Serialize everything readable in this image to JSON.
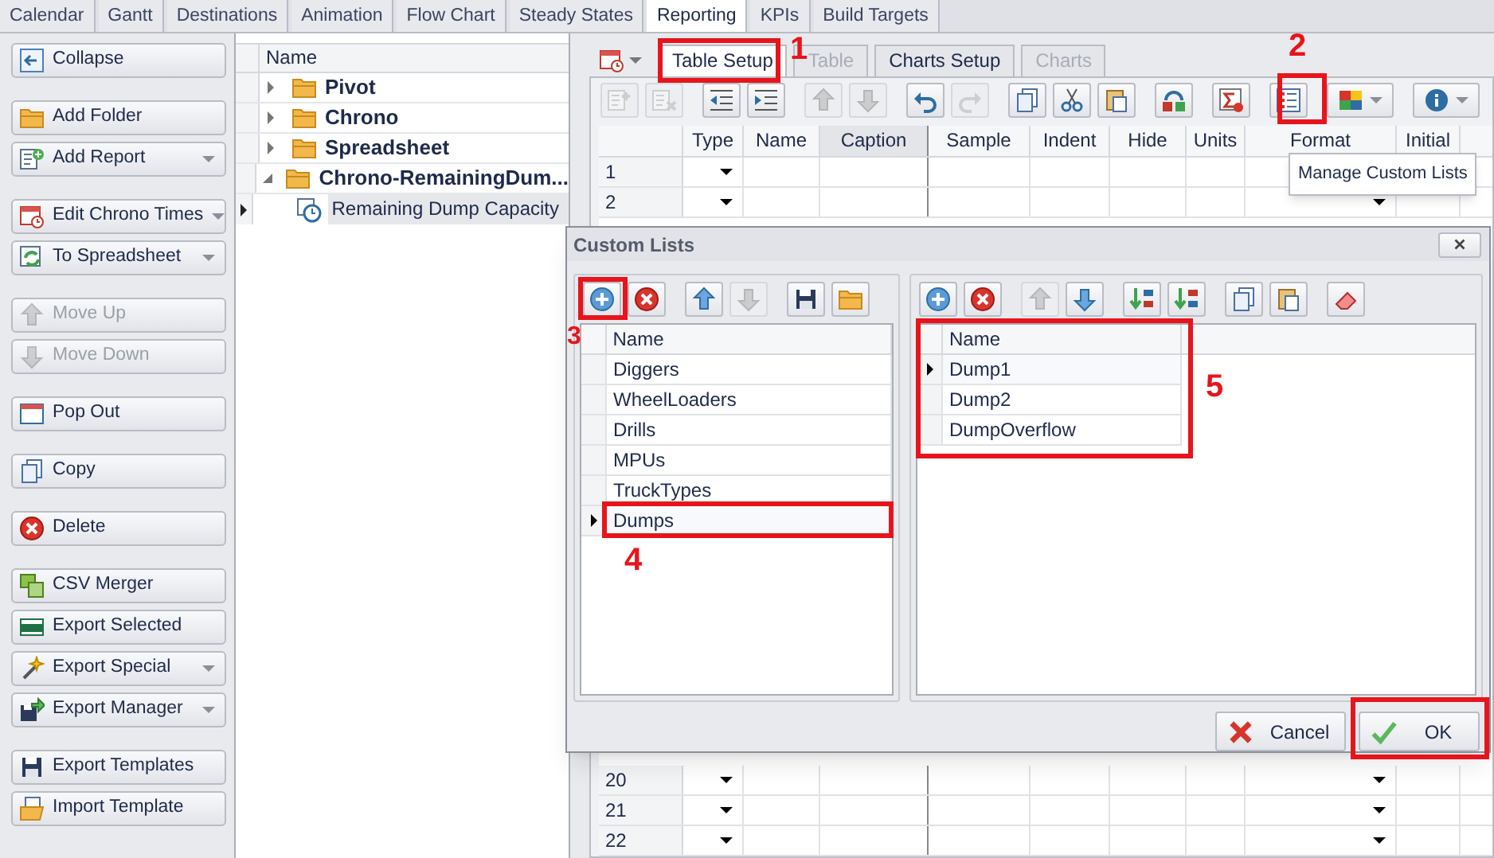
{
  "top_tabs": [
    {
      "label": "Calendar",
      "selected": false
    },
    {
      "label": "Gantt",
      "selected": false
    },
    {
      "label": "Destinations",
      "selected": false
    },
    {
      "label": "Animation",
      "selected": false
    },
    {
      "label": "Flow Chart",
      "selected": false
    },
    {
      "label": "Steady States",
      "selected": false
    },
    {
      "label": "Reporting",
      "selected": true
    },
    {
      "label": "KPIs",
      "selected": false
    },
    {
      "label": "Build Targets",
      "selected": false
    }
  ],
  "sidebar": {
    "groups": [
      [
        {
          "label": "Collapse",
          "kind": "collapse",
          "dropdown": false,
          "disabled": false
        }
      ],
      [
        {
          "label": "Add Folder",
          "kind": "folder",
          "dropdown": false,
          "disabled": false
        },
        {
          "label": "Add Report",
          "kind": "docplus",
          "dropdown": true,
          "disabled": false
        }
      ],
      [
        {
          "label": "Edit Chrono Times",
          "kind": "calclock",
          "dropdown": true,
          "disabled": false
        },
        {
          "label": "To Spreadsheet",
          "kind": "tablerefresh",
          "dropdown": true,
          "disabled": false
        }
      ],
      [
        {
          "label": "Move Up",
          "kind": "up",
          "dropdown": false,
          "disabled": true
        },
        {
          "label": "Move Down",
          "kind": "down",
          "dropdown": false,
          "disabled": true
        }
      ],
      [
        {
          "label": "Pop Out",
          "kind": "window",
          "dropdown": false,
          "disabled": false
        }
      ],
      [
        {
          "label": "Copy",
          "kind": "copy",
          "dropdown": false,
          "disabled": false
        }
      ],
      [
        {
          "label": "Delete",
          "kind": "delete",
          "dropdown": false,
          "disabled": false
        }
      ],
      [
        {
          "label": "CSV Merger",
          "kind": "csv",
          "dropdown": false,
          "disabled": false
        },
        {
          "label": "Export Selected",
          "kind": "xlsx",
          "dropdown": false,
          "disabled": false
        },
        {
          "label": "Export Special",
          "kind": "wand",
          "dropdown": true,
          "disabled": false
        },
        {
          "label": "Export Manager",
          "kind": "export",
          "dropdown": true,
          "disabled": false
        }
      ],
      [
        {
          "label": "Export Templates",
          "kind": "save",
          "dropdown": false,
          "disabled": false
        },
        {
          "label": "Import Template",
          "kind": "import",
          "dropdown": false,
          "disabled": false
        }
      ]
    ]
  },
  "tree": {
    "header": "Name",
    "items": [
      {
        "label": "Pivot",
        "expanded": false
      },
      {
        "label": "Chrono",
        "expanded": false
      },
      {
        "label": "Spreadsheet",
        "expanded": false
      },
      {
        "label": "Chrono-RemainingDum...",
        "expanded": true,
        "children": [
          {
            "label": "Remaining Dump Capacity",
            "selected": true
          }
        ]
      }
    ]
  },
  "report_tabs": [
    {
      "label": "Table Setup",
      "selected": true,
      "disabled": false
    },
    {
      "label": "Table",
      "selected": false,
      "disabled": true
    },
    {
      "label": "Charts Setup",
      "selected": false,
      "disabled": false
    },
    {
      "label": "Charts",
      "selected": false,
      "disabled": true
    }
  ],
  "toolbar": [
    [
      {
        "kind": "addrow",
        "disabled": true
      },
      {
        "kind": "delrow",
        "disabled": true
      }
    ],
    [
      {
        "kind": "outdent",
        "disabled": false
      },
      {
        "kind": "indent",
        "disabled": false
      }
    ],
    [
      {
        "kind": "up",
        "disabled": true
      },
      {
        "kind": "down",
        "disabled": true
      }
    ],
    [
      {
        "kind": "undo",
        "disabled": false
      },
      {
        "kind": "redo",
        "disabled": true
      }
    ],
    [
      {
        "kind": "copy",
        "disabled": false
      },
      {
        "kind": "cut",
        "disabled": false
      },
      {
        "kind": "paste",
        "disabled": false
      }
    ],
    [
      {
        "kind": "replace",
        "disabled": false
      }
    ],
    [
      {
        "kind": "sigma",
        "disabled": false
      }
    ],
    [
      {
        "kind": "list",
        "disabled": false
      }
    ],
    [
      {
        "kind": "colorgrid",
        "disabled": false,
        "dropdown": true
      }
    ],
    [
      {
        "kind": "info",
        "disabled": false,
        "dropdown": true
      }
    ]
  ],
  "grid": {
    "columns": [
      {
        "label": "Type",
        "selected": false
      },
      {
        "label": "Name",
        "selected": false
      },
      {
        "label": "Caption",
        "selected": true
      },
      {
        "label": "Sample",
        "selected": false
      },
      {
        "label": "Indent",
        "selected": false
      },
      {
        "label": "Hide",
        "selected": false
      },
      {
        "label": "Units",
        "selected": false
      },
      {
        "label": "Format",
        "selected": false
      },
      {
        "label": "Initial",
        "selected": false
      }
    ],
    "rows_top": [
      {
        "number": "1",
        "format_dropdown": false
      },
      {
        "number": "2",
        "format_dropdown": true
      }
    ],
    "rows_bottom": [
      {
        "number": "20",
        "format_dropdown": true
      },
      {
        "number": "21",
        "format_dropdown": true
      },
      {
        "number": "22",
        "format_dropdown": true
      }
    ]
  },
  "tooltip": "Manage Custom Lists",
  "dialog": {
    "title": "Custom Lists",
    "left_toolbar": [
      [
        {
          "kind": "plus",
          "disabled": false
        },
        {
          "kind": "delete",
          "disabled": false
        }
      ],
      [
        {
          "kind": "up",
          "disabled": false
        },
        {
          "kind": "down",
          "disabled": true
        }
      ],
      [
        {
          "kind": "save",
          "disabled": false
        },
        {
          "kind": "folder",
          "disabled": false
        }
      ]
    ],
    "left_list": {
      "header": "Name",
      "rows": [
        {
          "label": "Diggers",
          "selected": false
        },
        {
          "label": "WheelLoaders",
          "selected": false
        },
        {
          "label": "Drills",
          "selected": false
        },
        {
          "label": "MPUs",
          "selected": false
        },
        {
          "label": "TruckTypes",
          "selected": false
        },
        {
          "label": "Dumps",
          "selected": true
        }
      ]
    },
    "right_toolbar": [
      [
        {
          "kind": "plus",
          "disabled": false
        },
        {
          "kind": "delete",
          "disabled": false
        }
      ],
      [
        {
          "kind": "up",
          "disabled": true
        },
        {
          "kind": "down",
          "disabled": false
        }
      ],
      [
        {
          "kind": "sortaz",
          "disabled": false
        },
        {
          "kind": "sortza",
          "disabled": false
        }
      ],
      [
        {
          "kind": "copy",
          "disabled": false
        },
        {
          "kind": "paste",
          "disabled": false
        }
      ],
      [
        {
          "kind": "eraser",
          "disabled": false
        }
      ]
    ],
    "right_list": {
      "header": "Name",
      "rows": [
        {
          "label": "Dump1",
          "selected": true
        },
        {
          "label": "Dump2",
          "selected": false
        },
        {
          "label": "DumpOverflow",
          "selected": false
        }
      ]
    },
    "buttons": [
      {
        "label": "Cancel",
        "kind": "cancel"
      },
      {
        "label": "OK",
        "kind": "ok"
      }
    ]
  },
  "annotations": [
    {
      "label": "1"
    },
    {
      "label": "2"
    },
    {
      "label": "3"
    },
    {
      "label": "4"
    },
    {
      "label": "5"
    }
  ]
}
